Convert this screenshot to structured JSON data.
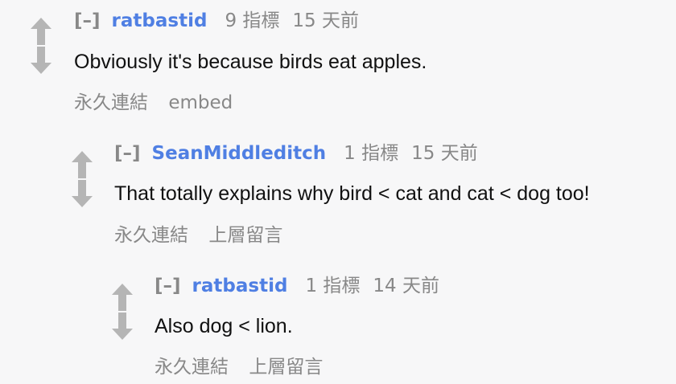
{
  "colors": {
    "background": "#f7f7f8",
    "author": "#4f7fe3",
    "meta": "#888888",
    "body_text": "#111111",
    "arrow": "#b5b5b5"
  },
  "comments": [
    {
      "expand": "[–]",
      "author": "ratbastid",
      "score": "9 指標",
      "time": "15 天前",
      "body": "Obviously it's because birds eat apples.",
      "buttons": [
        "永久連結",
        "embed"
      ]
    },
    {
      "expand": "[–]",
      "author": "SeanMiddleditch",
      "score": "1 指標",
      "time": "15 天前",
      "body": "That totally explains why bird < cat and cat < dog too!",
      "buttons": [
        "永久連結",
        "上層留言"
      ]
    },
    {
      "expand": "[–]",
      "author": "ratbastid",
      "score": "1 指標",
      "time": "14 天前",
      "body": "Also dog < lion.",
      "buttons": [
        "永久連結",
        "上層留言"
      ]
    }
  ]
}
